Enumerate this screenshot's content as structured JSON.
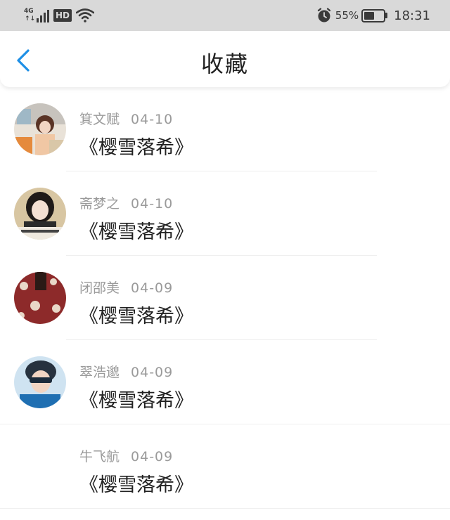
{
  "status_bar": {
    "network_type": "4G",
    "network_arrows": "↑↓",
    "hd_label": "HD",
    "battery_percent": "55%",
    "battery_level": 0.55,
    "time": "18:31",
    "icons": [
      "signal-icon",
      "hd-icon",
      "wifi-icon",
      "alarm-icon",
      "battery-icon"
    ]
  },
  "header": {
    "back_icon": "chevron-left-icon",
    "title": "收藏",
    "accent_color": "#1e8fe6"
  },
  "favorites": [
    {
      "name": "箕文赋",
      "date": "04-10",
      "title": "《樱雪落希》",
      "avatar": "photo-avatar"
    },
    {
      "name": "斋梦之",
      "date": "04-10",
      "title": "《樱雪落希》",
      "avatar": "photo-avatar"
    },
    {
      "name": "闭邵美",
      "date": "04-09",
      "title": "《樱雪落希》",
      "avatar": "photo-avatar"
    },
    {
      "name": "翠浩邈",
      "date": "04-09",
      "title": "《樱雪落希》",
      "avatar": "photo-avatar"
    },
    {
      "name": "牛飞航",
      "date": "04-09",
      "title": "《樱雪落希》",
      "avatar": "none"
    }
  ]
}
